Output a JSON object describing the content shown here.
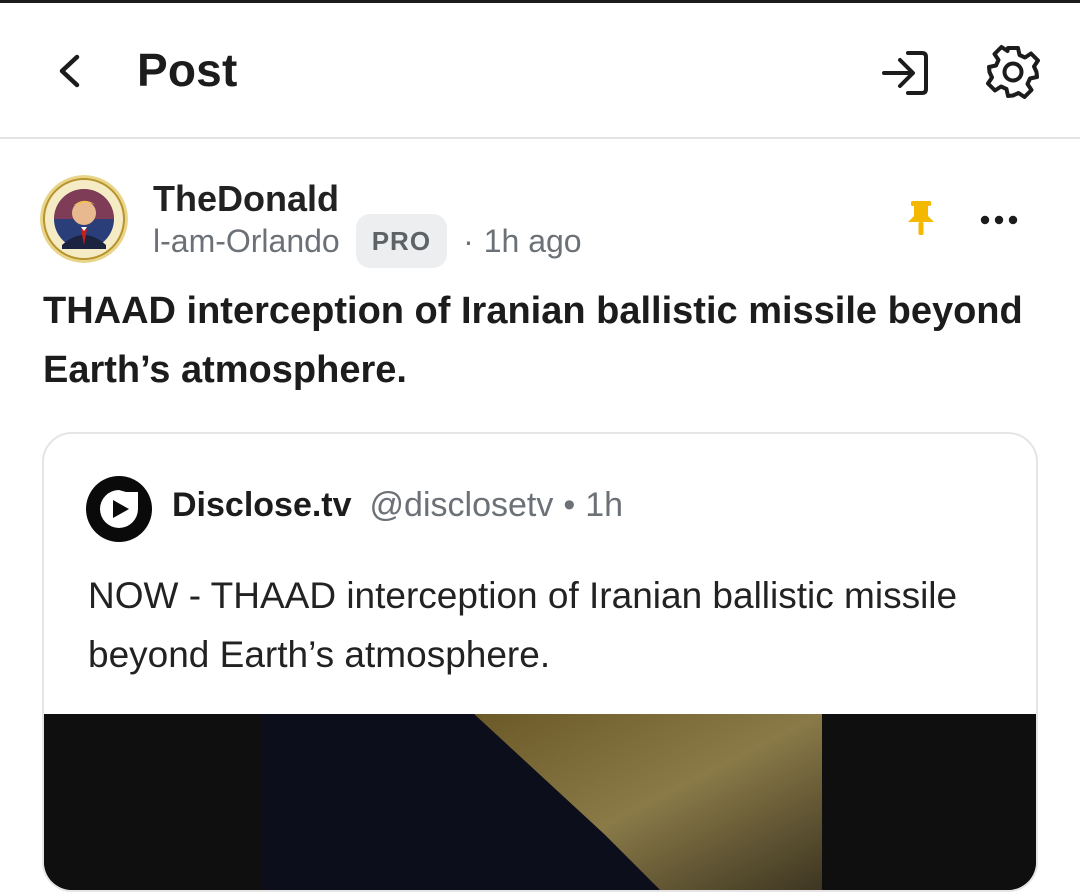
{
  "header": {
    "title": "Post",
    "back_icon": "chevron-left-icon",
    "login_icon": "login-icon",
    "settings_icon": "gear-icon"
  },
  "post": {
    "author_name": "TheDonald",
    "author_handle": "l-am-Orlando",
    "badge": "PRO",
    "separator": "·",
    "time": "1h ago",
    "pinned": true,
    "pin_color": "#f5b800",
    "text": "THAAD interception of Iranian ballistic missile beyond Earth’s atmosphere."
  },
  "embed": {
    "source_name": "Disclose.tv",
    "source_handle": "@disclosetv",
    "separator": "•",
    "time": "1h",
    "text": "NOW - THAAD interception of Iranian ballistic missile beyond Earth’s atmosphere."
  }
}
